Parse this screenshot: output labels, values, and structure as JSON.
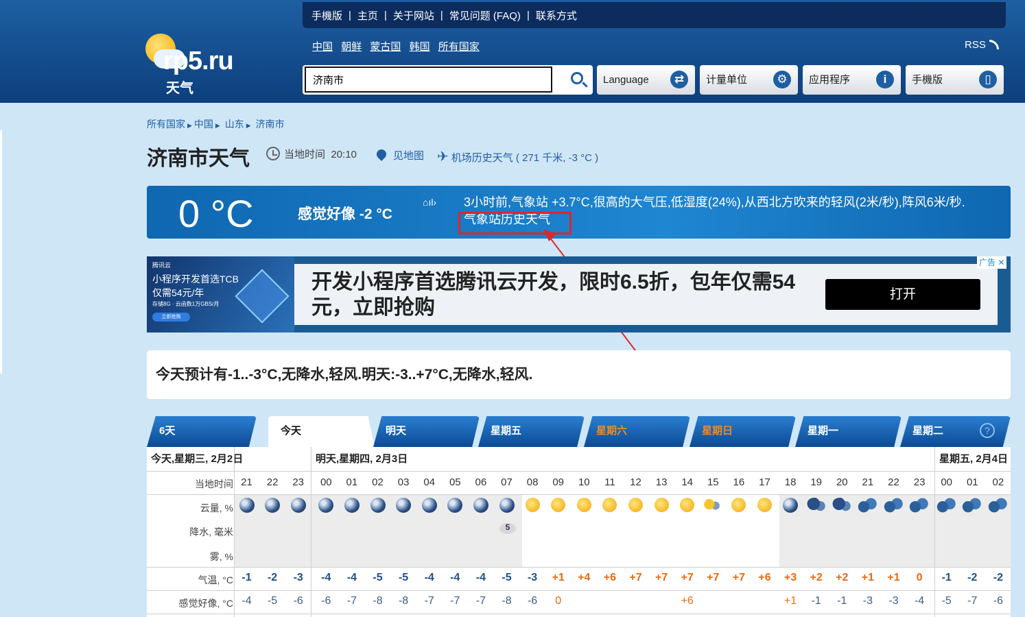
{
  "topbar": {
    "links": [
      "手機版",
      "主页",
      "关于网站",
      "常见问题 (FAQ)",
      "联系方式"
    ],
    "separator": "|"
  },
  "logo": {
    "brand": "rp5.ru",
    "sub": "天气"
  },
  "countries": [
    "中国",
    "朝鲜",
    "蒙古国",
    "韩国",
    "所有国家"
  ],
  "rss": "RSS",
  "search": {
    "value": "济南市"
  },
  "buttons": [
    {
      "label": "Language",
      "icon": "translate-icon"
    },
    {
      "label": "计量单位",
      "icon": "gear-icon"
    },
    {
      "label": "应用程序",
      "icon": "info-icon"
    },
    {
      "label": "手機版",
      "icon": "mobile-icon"
    }
  ],
  "breadcrumb": [
    "所有国家",
    "中国",
    "山东",
    "济南市"
  ],
  "page": {
    "title": "济南市天气",
    "local_time_label": "当地时间",
    "local_time": "20:10",
    "map_link": "见地图",
    "airport_link": "机场历史天气 ( 271 千米, -3 °C )"
  },
  "now": {
    "temp": "0 °C",
    "feels": "感觉好像 -2 °C",
    "station_text": "3小时前,气象站 +3.7°C,很高的大气压,低湿度(24%),从西北方吹来的轻风(2米/秒),阵风6米/秒.",
    "station_link": "气象站历史天气"
  },
  "ad": {
    "left_brand": "腾讯云",
    "left_line1": "小程序开发首选TCB",
    "left_line2": "仅需54元/年",
    "left_line3": "存储8G · 云函数1万GBS/月",
    "left_button": "立即抢购",
    "title": "开发小程序首选腾讯云开发，限时6.5折，包年仅需54元，立即抢购",
    "open": "打开",
    "tag": "广告"
  },
  "summary": "今天预计有-1..-3°C,无降水,轻风.明天:-3..+7°C,无降水,轻风.",
  "tabs": [
    {
      "label": "6天",
      "weekend": false,
      "active": false
    },
    {
      "label": "今天",
      "weekend": false,
      "active": true
    },
    {
      "label": "明天",
      "weekend": false,
      "active": false
    },
    {
      "label": "星期五",
      "weekend": false,
      "active": false
    },
    {
      "label": "星期六",
      "weekend": true,
      "active": false
    },
    {
      "label": "星期日",
      "weekend": true,
      "active": false
    },
    {
      "label": "星期一",
      "weekend": false,
      "active": false
    },
    {
      "label": "星期二",
      "weekend": false,
      "active": false
    }
  ],
  "help": "?",
  "forecast": {
    "days": [
      "今天,星期三, 2月2日",
      "明天,星期四, 2月3日",
      "星期五, 2月4日"
    ],
    "row_labels": [
      "当地时间",
      "云量, %",
      "降水, 毫米",
      "雾, %",
      "气温, °C",
      "感觉好像, °C"
    ],
    "hours": [
      "21",
      "22",
      "23",
      "00",
      "01",
      "02",
      "03",
      "04",
      "05",
      "06",
      "07",
      "08",
      "09",
      "10",
      "11",
      "12",
      "13",
      "14",
      "15",
      "16",
      "17",
      "18",
      "19",
      "20",
      "21",
      "22",
      "23",
      "00",
      "01",
      "02"
    ],
    "icons": [
      "moon",
      "moon",
      "moon",
      "moon",
      "moon",
      "moon",
      "moon",
      "moon",
      "moon",
      "moon",
      "moon",
      "sun",
      "sun",
      "sun",
      "sun",
      "sun",
      "sun",
      "sun",
      "suncloud",
      "sun",
      "sun",
      "moon",
      "cloudmoon",
      "cloudmoon",
      "clouds",
      "clouds",
      "clouds",
      "clouds",
      "clouds",
      "clouds"
    ],
    "fog_value": "5",
    "temps": [
      "-1",
      "-2",
      "-3",
      "-4",
      "-4",
      "-5",
      "-5",
      "-4",
      "-4",
      "-4",
      "-5",
      "-3",
      "+1",
      "+4",
      "+6",
      "+7",
      "+7",
      "+7",
      "+7",
      "+7",
      "+6",
      "+3",
      "+2",
      "+2",
      "+1",
      "+1",
      "0",
      "-1",
      "-2",
      "-2"
    ],
    "feels": [
      "-4",
      "-5",
      "-6",
      "-6",
      "-7",
      "-8",
      "-8",
      "-7",
      "-7",
      "-7",
      "-8",
      "-6",
      "0",
      "",
      "",
      "",
      "",
      "+6",
      "",
      "",
      "",
      "+1",
      "-1",
      "-1",
      "-3",
      "-3",
      "-4",
      "-5",
      "-7",
      "-6"
    ]
  }
}
